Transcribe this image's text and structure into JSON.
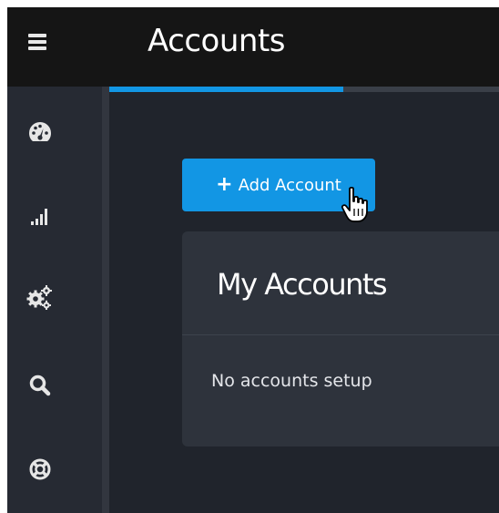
{
  "header": {
    "menu_icon": "hamburger-menu-icon",
    "title": "Accounts"
  },
  "tabs": {
    "active_progress": 0.6
  },
  "sidebar": {
    "items": [
      {
        "icon": "dashboard-gauge-icon",
        "label": "Dashboard"
      },
      {
        "icon": "signal-bars-icon",
        "label": "Statistics"
      },
      {
        "icon": "gears-icon",
        "label": "Settings"
      },
      {
        "icon": "search-icon",
        "label": "Search"
      },
      {
        "icon": "lifebuoy-icon",
        "label": "Support"
      }
    ]
  },
  "main": {
    "add_button_label": "Add Account",
    "add_button_icon": "plus-icon",
    "panel": {
      "title": "My Accounts",
      "empty_message": "No accounts setup"
    }
  },
  "colors": {
    "accent": "#1296e4",
    "header_bg": "#151515",
    "page_bg": "#20242c",
    "panel_bg": "#2e333c"
  }
}
